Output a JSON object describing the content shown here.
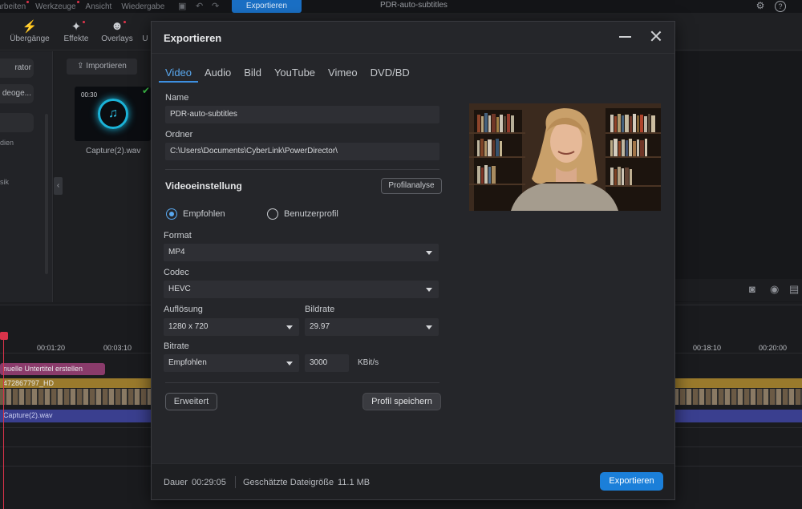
{
  "app": {
    "menu": [
      "arbeiten",
      "Werkzeuge",
      "Ansicht",
      "Wiedergabe"
    ],
    "export_button": "Exportieren",
    "project_title": "PDR-auto-subtitles",
    "toolbar": [
      "Übergänge",
      "Effekte",
      "Overlays",
      "U"
    ],
    "left_panel": {
      "buttons": [
        "rator",
        "deoge..."
      ],
      "texts": [
        "dien",
        "sik"
      ]
    },
    "media": {
      "import_label": "Importieren",
      "duration": "00:30",
      "filename": "Capture(2).wav"
    },
    "timeline": {
      "ruler_labels": [
        "00:01:20",
        "00:03:10",
        "00:18:10",
        "00:20:00"
      ],
      "clip_subtitle": "nuelle Untertitel erstellen",
      "clip_video": "472867797_HD",
      "clip_audio": "Capture(2).wav"
    }
  },
  "dialog": {
    "title": "Exportieren",
    "tabs": [
      "Video",
      "Audio",
      "Bild",
      "YouTube",
      "Vimeo",
      "DVD/BD"
    ],
    "active_tab": "Video",
    "name_label": "Name",
    "name_value": "PDR-auto-subtitles",
    "folder_label": "Ordner",
    "folder_value": "C:\\Users\\Documents\\CyberLink\\PowerDirector\\",
    "section_title": "Videoeinstellung",
    "profile_analysis": "Profilanalyse",
    "radio_recommended": "Empfohlen",
    "radio_custom": "Benutzerprofil",
    "format_label": "Format",
    "format_value": "MP4",
    "codec_label": "Codec",
    "codec_value": "HEVC",
    "resolution_label": "Auflösung",
    "resolution_value": "1280 x 720",
    "framerate_label": "Bildrate",
    "framerate_value": "29.97",
    "bitrate_label": "Bitrate",
    "bitrate_mode": "Empfohlen",
    "bitrate_value": "3000",
    "bitrate_unit": "KBit/s",
    "advanced_button": "Erweitert",
    "save_profile_button": "Profil speichern",
    "duration_label": "Dauer",
    "duration_value": "00:29:05",
    "filesize_label": "Geschätzte Dateigröße",
    "filesize_value": "11.1 MB",
    "export_button": "Exportieren"
  },
  "colors": {
    "accent": "#1b7fd9",
    "active_tab": "#5aa9f0"
  }
}
